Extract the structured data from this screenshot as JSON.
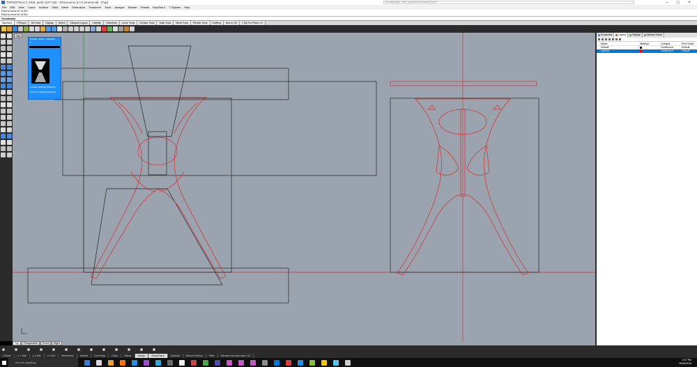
{
  "window": {
    "title": "TOPDSTRUCT_R09_lamb (227 KB) - Rhinoceros 5.0 Commercial - [Top]",
    "ext_input": "Einstellungen - (dfR_Adsachnaf-Gelatsin)Cann?"
  },
  "menu": [
    "File",
    "Edit",
    "View",
    "Curve",
    "Surface",
    "Solid",
    "Mesh",
    "Dimension",
    "Transform",
    "Tools",
    "Analyze",
    "Render",
    "Panels",
    "KeyShot 4",
    "T-Splines",
    "Help"
  ],
  "command_area": {
    "line1": "Point to move to <0.00>",
    "line2": "Point to move to <0.00>:",
    "prompt": "Command:"
  },
  "toolbar_tabs": [
    "Standard",
    "CPlanes",
    "Set View",
    "Display",
    "Select",
    "Viewport Layout",
    "Visibility",
    "Transform",
    "Curve Tools",
    "Surface Tools",
    "Solid Tools",
    "Mesh Tools",
    "Render Tools",
    "Drafting",
    "New in V5",
    "T-Spl For Rhino 2.0"
  ],
  "viewport": {
    "label": "Top",
    "view_tabs": [
      "Top",
      "Perspective",
      "Front",
      "Right"
    ],
    "layer_window": {
      "row1": "Untitled - Rhino - (4000)(0)",
      "row2": "0",
      "row3": "Untitled (4000)(0) (8080)(2)",
      "row4": "TopView (4000)(0)(2)(00)(1)"
    }
  },
  "snaps": [
    "End",
    "Near",
    "Point",
    "Mid",
    "Cen",
    "Int",
    "Perp",
    "Tan",
    "Quad",
    "Knot",
    "Vertex",
    "Project",
    "Disable"
  ],
  "status": {
    "cplane": "CPlane",
    "x": "x -1.988",
    "y": "y 2.880",
    "z": "z 0.000",
    "units": "Millimeters",
    "layer": "Default",
    "grid_snap": "Grid Snap",
    "ortho": "Ortho",
    "planar": "Planar",
    "osnap": "Osnap",
    "smarttrack": "SmartTrack",
    "gumball": "Gumball",
    "record_history": "Record History",
    "filter": "Filter",
    "memory": "Minutes from last save: 43"
  },
  "taskbar": {
    "search": "Ask me anything",
    "time": "2:07 PM",
    "date": "09/06/2016",
    "icon_colors": [
      "#3a7bd5",
      "#d9d9d9",
      "#e8a33d",
      "#ff7300",
      "#2b8de5",
      "#9b4dca",
      "#30a9de",
      "#6a6a6a",
      "#f0f0f0",
      "#c24848",
      "#4aa84a",
      "#4d4da0",
      "#c05cc0",
      "#c05cc0",
      "#c05cc0",
      "#8c8c8c",
      "#0078d7",
      "#d43f3f",
      "#2b8de5",
      "#8cbf3f",
      "#f1c40f",
      "#56c6e8",
      "#cccccc"
    ]
  },
  "panel": {
    "tabs": [
      "Properties",
      "Layers",
      "Display",
      "Named Views"
    ],
    "columns": [
      "Name",
      "Material",
      "Linetype",
      "Print Width"
    ],
    "layers": [
      {
        "name": "Default",
        "material": "",
        "linetype": "Continuous",
        "print_width": "Default",
        "color": "#000000",
        "selected": false
      },
      {
        "name": "outlines",
        "material": "",
        "linetype": "Continuous",
        "print_width": "Default",
        "color": "#ff0000",
        "selected": true
      }
    ]
  },
  "colors": {
    "viewport_bg": "#9aa3ae",
    "curve_red": "#d92a2a",
    "curve_black": "#222222",
    "axis_red": "#c83030",
    "axis_green": "#2e8b3a",
    "accent_blue": "#1e90ff"
  }
}
